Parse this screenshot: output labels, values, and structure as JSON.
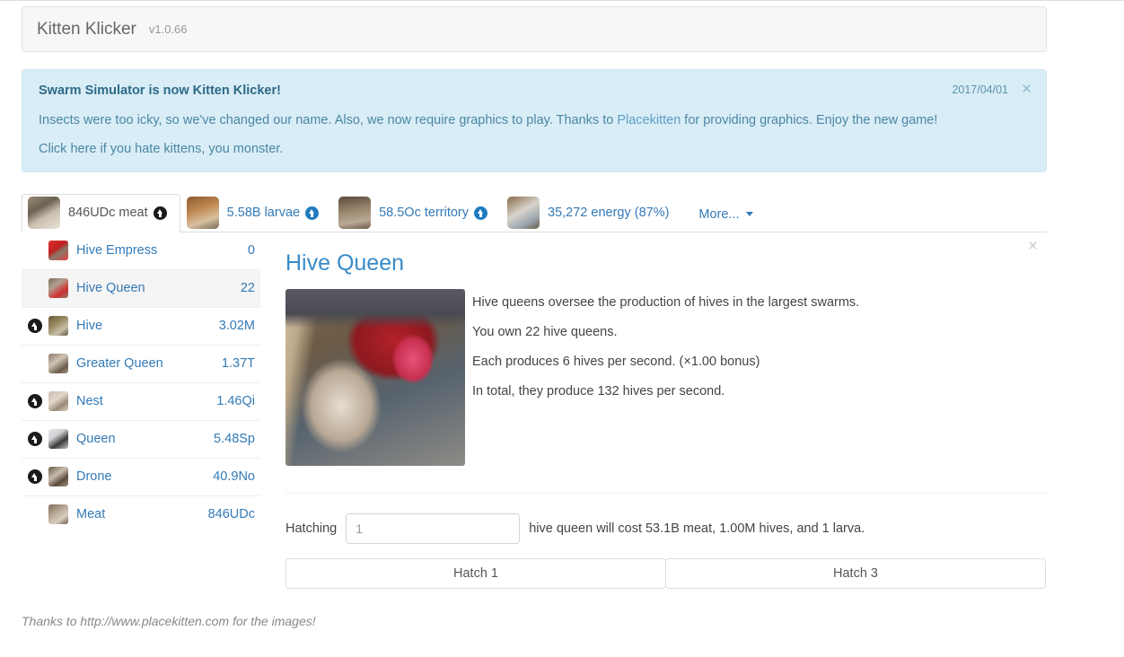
{
  "header": {
    "title": "Kitten Klicker",
    "version": "v1.0.66"
  },
  "alert": {
    "title": "Swarm Simulator is now Kitten Klicker!",
    "date": "2017/04/01",
    "close_label": "×",
    "body_before_link": "Insects were too icky, so we've changed our name. Also, we now require graphics to play. Thanks to ",
    "body_link": "Placekitten",
    "body_after_link": " for providing graphics. Enjoy the new game!",
    "note": "Click here if you hate kittens, you monster."
  },
  "tabs": {
    "items": [
      {
        "label": "846UDc meat",
        "active": true,
        "has_upgrade": true,
        "icon": "kitten-thumb-meat"
      },
      {
        "label": "5.58B larvae",
        "active": false,
        "has_upgrade": true,
        "icon": "kitten-thumb-larvae"
      },
      {
        "label": "58.5Oc territory",
        "active": false,
        "has_upgrade": true,
        "icon": "kitten-thumb-territory"
      },
      {
        "label": "35,272 energy (87%)",
        "active": false,
        "has_upgrade": false,
        "icon": "kitten-thumb-energy"
      }
    ],
    "more_label": "More..."
  },
  "unit_list": [
    {
      "name": "Hive Empress",
      "count": "0",
      "upgrade": false,
      "selected": false,
      "icon": "kitten-thumb-hive-empress"
    },
    {
      "name": "Hive Queen",
      "count": "22",
      "upgrade": false,
      "selected": true,
      "icon": "kitten-thumb-hive-queen"
    },
    {
      "name": "Hive",
      "count": "3.02M",
      "upgrade": true,
      "selected": false,
      "icon": "kitten-thumb-hive"
    },
    {
      "name": "Greater Queen",
      "count": "1.37T",
      "upgrade": false,
      "selected": false,
      "icon": "kitten-thumb-greater-queen"
    },
    {
      "name": "Nest",
      "count": "1.46Qi",
      "upgrade": true,
      "selected": false,
      "icon": "kitten-thumb-nest"
    },
    {
      "name": "Queen",
      "count": "5.48Sp",
      "upgrade": true,
      "selected": false,
      "icon": "kitten-thumb-queen"
    },
    {
      "name": "Drone",
      "count": "40.9No",
      "upgrade": true,
      "selected": false,
      "icon": "kitten-thumb-drone"
    },
    {
      "name": "Meat",
      "count": "846UDc",
      "upgrade": false,
      "selected": false,
      "icon": "kitten-thumb-meat-unit"
    }
  ],
  "detail": {
    "title": "Hive Queen",
    "close_label": "×",
    "image_alt": "kitten-photo-hive-queen",
    "lines": [
      "Hive queens oversee the production of hives in the largest swarms.",
      "You own 22 hive queens.",
      "Each produces 6 hives per second. (×1.00 bonus)",
      "In total, they produce 132 hives per second."
    ],
    "hatch_label": "Hatching",
    "hatch_value": "1",
    "hatch_placeholder": "1",
    "hatch_desc": "hive queen will cost 53.1B meat, 1.00M hives, and 1 larva.",
    "buttons": [
      {
        "label": "Hatch 1"
      },
      {
        "label": "Hatch 3"
      }
    ]
  },
  "footer": {
    "text_before": "Thanks to ",
    "link": "http://www.placekitten.com",
    "text_after": " for the images!"
  },
  "colors": {
    "link": "#337ab7",
    "heading": "#3a8bc9",
    "alert_bg": "#d9edf7",
    "alert_text": "#31708f",
    "selected_row": "#f5f5f5",
    "upgrade_badge": "#1f7bbf"
  }
}
